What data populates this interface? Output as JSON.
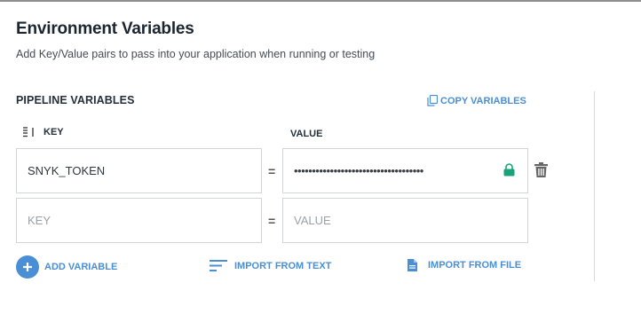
{
  "header": {
    "title": "Environment Variables",
    "subtitle": "Add Key/Value pairs to pass into your application when running or testing"
  },
  "pipeline": {
    "section_title": "PIPELINE VARIABLES",
    "copy_label": "COPY VARIABLES",
    "key_header": "KEY",
    "value_header": "VALUE",
    "rows": [
      {
        "key": "SNYK_TOKEN",
        "value_masked": "••••••••••••••••••••••••••••••••••••"
      }
    ],
    "new_row": {
      "key_placeholder": "KEY",
      "value_placeholder": "VALUE"
    },
    "equals_sign": "="
  },
  "actions": {
    "add_variable": "ADD VARIABLE",
    "import_text": "IMPORT FROM TEXT",
    "import_file": "IMPORT FROM FILE"
  },
  "colors": {
    "accent": "#4a8fd6",
    "lock": "#1aa37a",
    "border": "#d3d6d9"
  }
}
